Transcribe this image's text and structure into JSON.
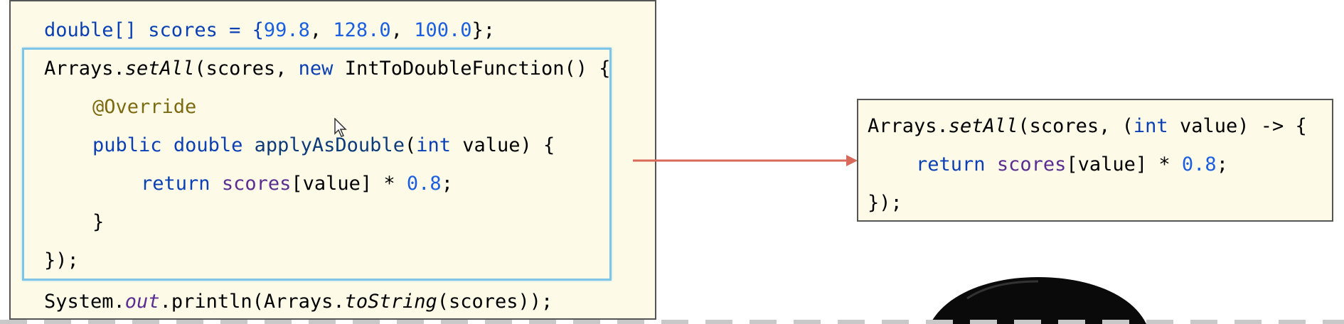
{
  "left_code": {
    "line1": {
      "t1": "double[] scores = {",
      "n1": "99.8",
      "c1": ", ",
      "n2": "128.0",
      "c2": ", ",
      "n3": "100.0",
      "t2": "};"
    },
    "line2": {
      "t1": "Arrays.",
      "m": "setAll",
      "t2": "(scores, ",
      "kw": "new",
      "t3": " IntToDoubleFunction() {"
    },
    "line3": {
      "ann": "@Override"
    },
    "line4": {
      "kw1": "public",
      "sp1": " ",
      "kw2": "double",
      "sp2": " ",
      "fn": "applyAsDouble",
      "t1": "(",
      "kw3": "int",
      "t2": " value) {"
    },
    "line5": {
      "kw": "return",
      "sp": " ",
      "var": "scores",
      "t1": "[value] * ",
      "num": "0.8",
      "t2": ";"
    },
    "line6": {
      "t": "}"
    },
    "line7": {
      "t": "});"
    },
    "line8": {
      "t1": "System.",
      "f": "out",
      "t2": ".println(Arrays.",
      "m": "toString",
      "t3": "(scores));"
    }
  },
  "right_code": {
    "line1": {
      "t1": "Arrays.",
      "m": "setAll",
      "t2": "(scores, (",
      "kw": "int",
      "t3": " value) -> {"
    },
    "line2": {
      "kw": "return",
      "sp": " ",
      "var": "scores",
      "t1": "[value] * ",
      "num": "0.8",
      "t2": ";"
    },
    "line3": {
      "t": "});"
    }
  },
  "colors": {
    "panel_bg": "#fdfbe7",
    "keyword": "#0b3fb4",
    "number": "#1b5fe0",
    "annotation": "#7c6a12",
    "field": "#5a2d91",
    "selection_border": "#7ec5e8",
    "arrow": "#d9695a"
  },
  "icons": {
    "cursor": "mouse-pointer-icon",
    "arrow": "right-arrow-icon"
  }
}
